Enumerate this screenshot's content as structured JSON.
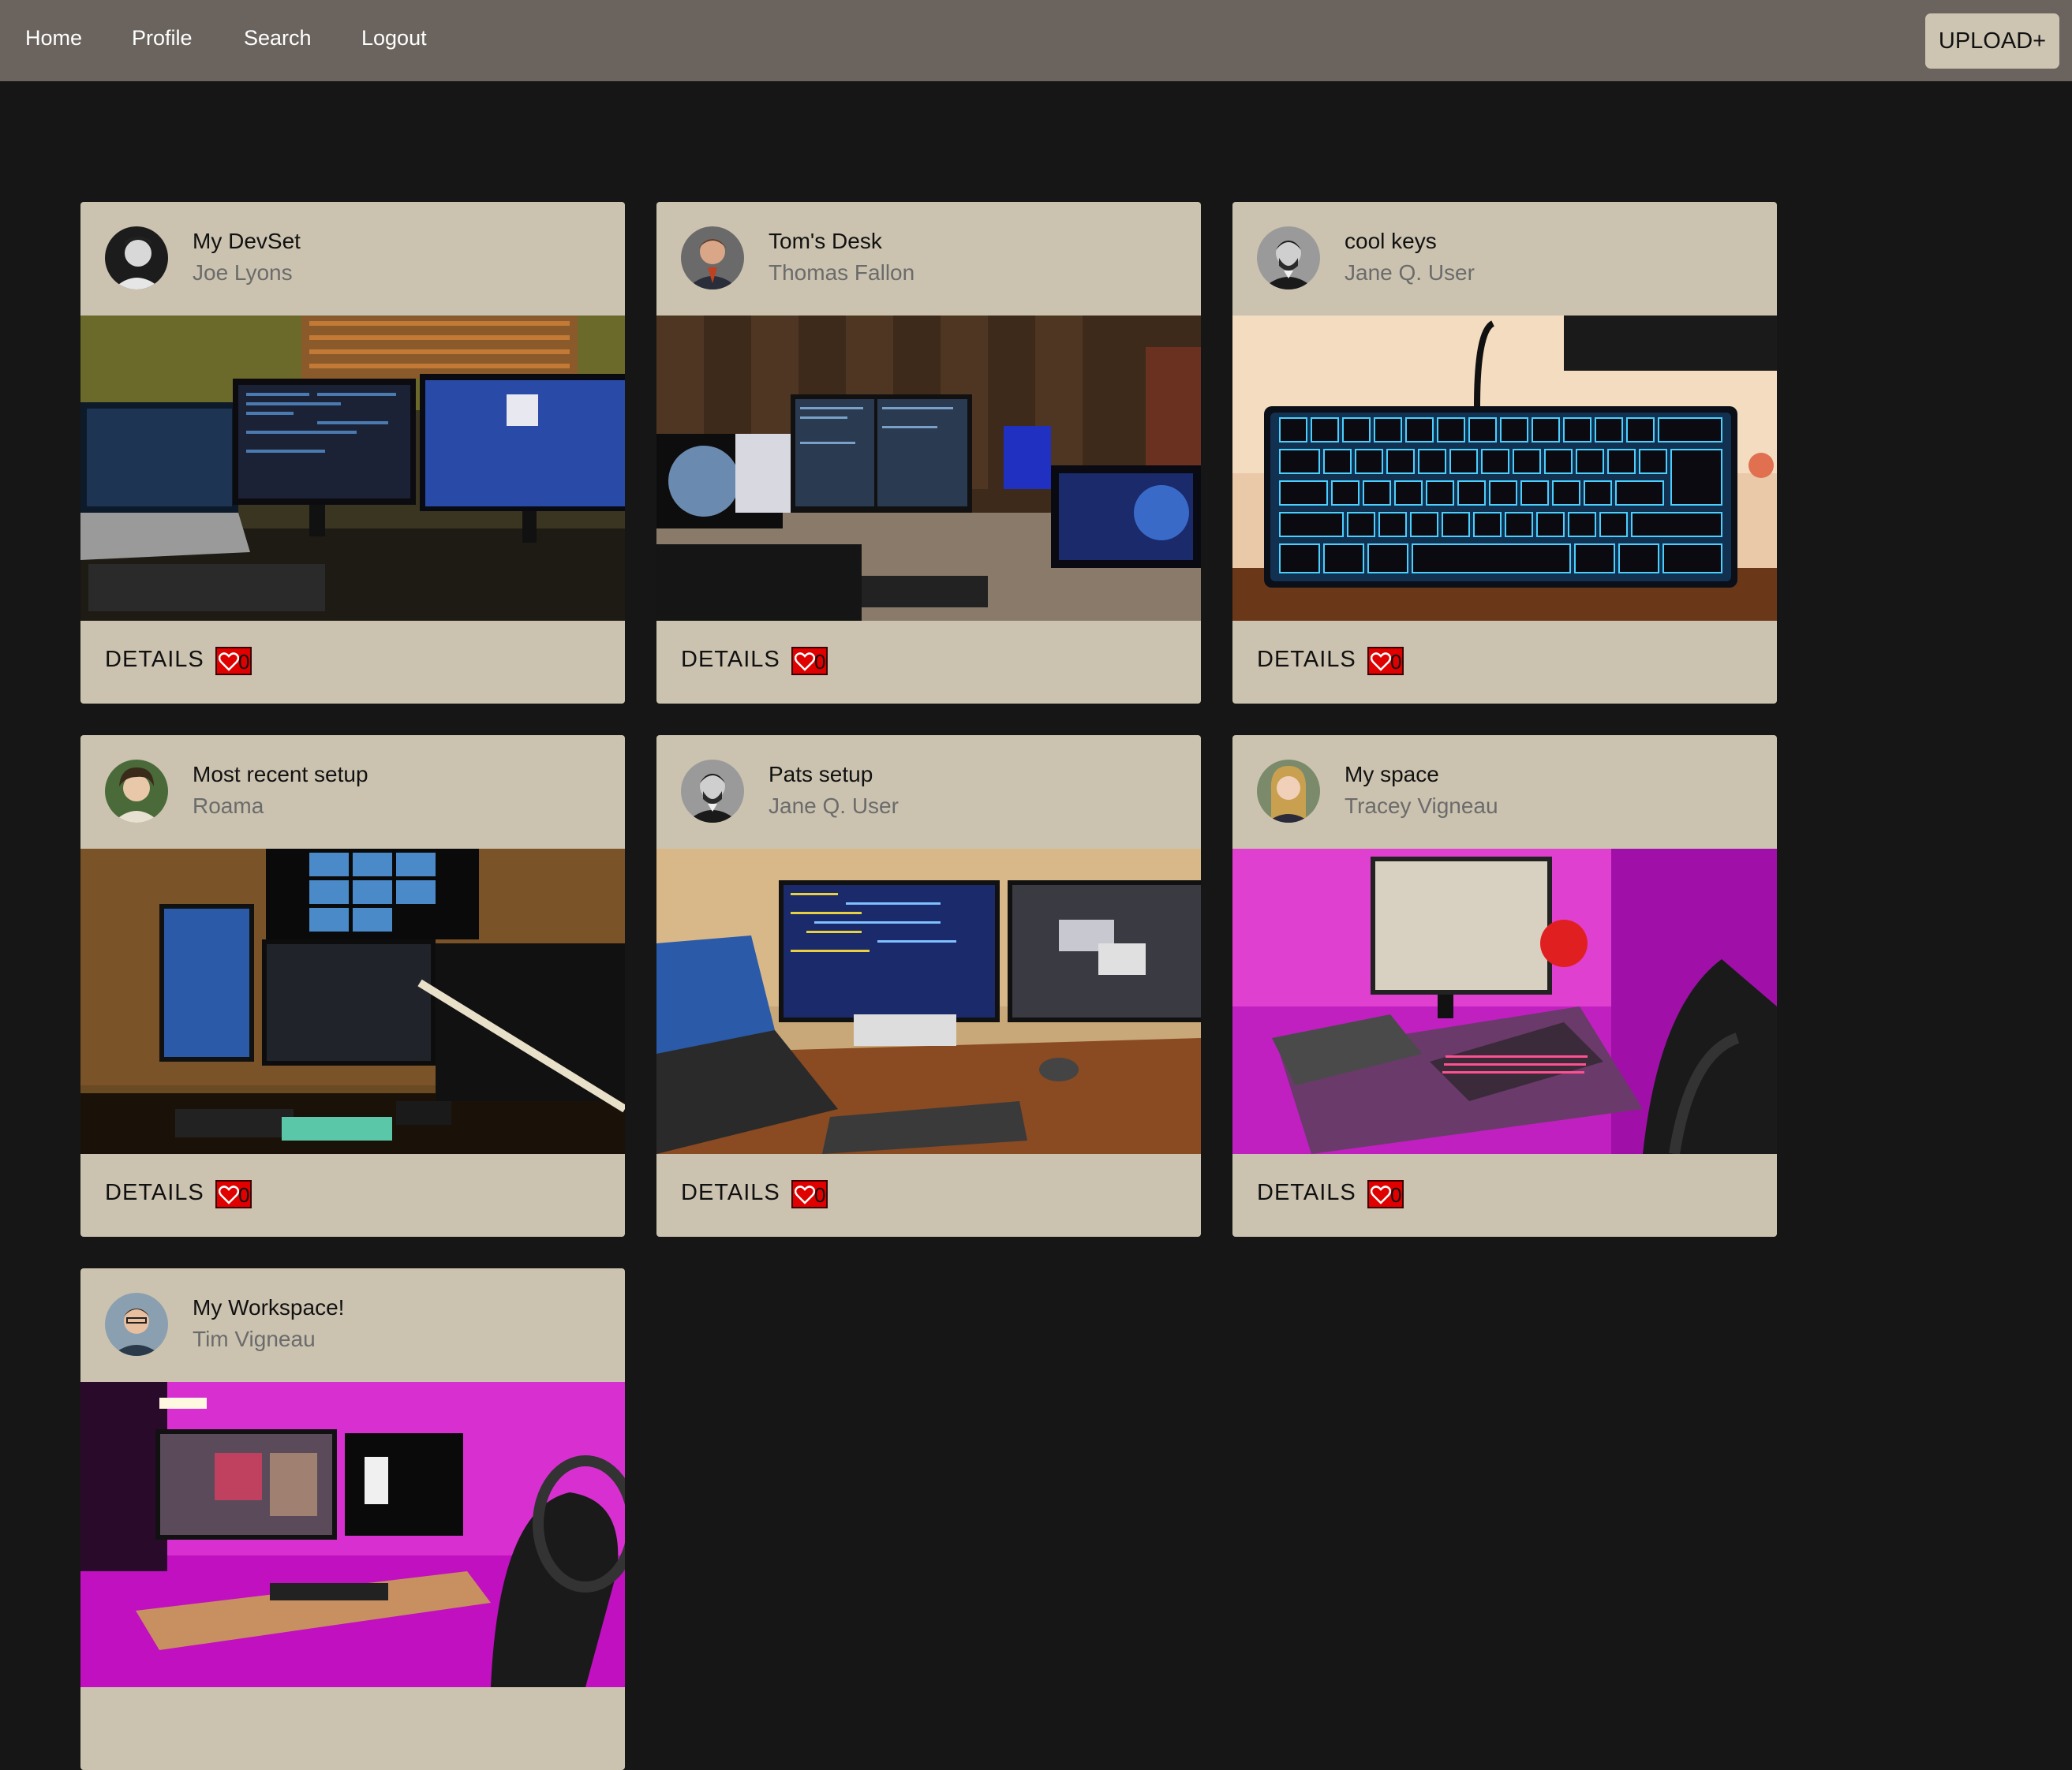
{
  "nav": {
    "links": [
      "Home",
      "Profile",
      "Search",
      "Logout"
    ],
    "upload_label": "UPLOAD+"
  },
  "cards": [
    {
      "title": "My DevSet",
      "author": "Joe Lyons",
      "details_label": "DETAILS",
      "likes": "0"
    },
    {
      "title": "Tom's Desk",
      "author": "Thomas Fallon",
      "details_label": "DETAILS",
      "likes": "0"
    },
    {
      "title": "cool keys",
      "author": "Jane Q. User",
      "details_label": "DETAILS",
      "likes": "0"
    },
    {
      "title": "Most recent setup",
      "author": "Roama",
      "details_label": "DETAILS",
      "likes": "0"
    },
    {
      "title": "Pats setup",
      "author": "Jane Q. User",
      "details_label": "DETAILS",
      "likes": "0"
    },
    {
      "title": "My space",
      "author": "Tracey Vigneau",
      "details_label": "DETAILS",
      "likes": "0"
    },
    {
      "title": "My Workspace!",
      "author": "Tim Vigneau",
      "details_label": "DETAILS",
      "likes": "0"
    }
  ],
  "colors": {
    "navbar": "#6b645e",
    "page_background": "#161616",
    "card_background": "#cbc3b0",
    "like_button": "#e00000"
  }
}
